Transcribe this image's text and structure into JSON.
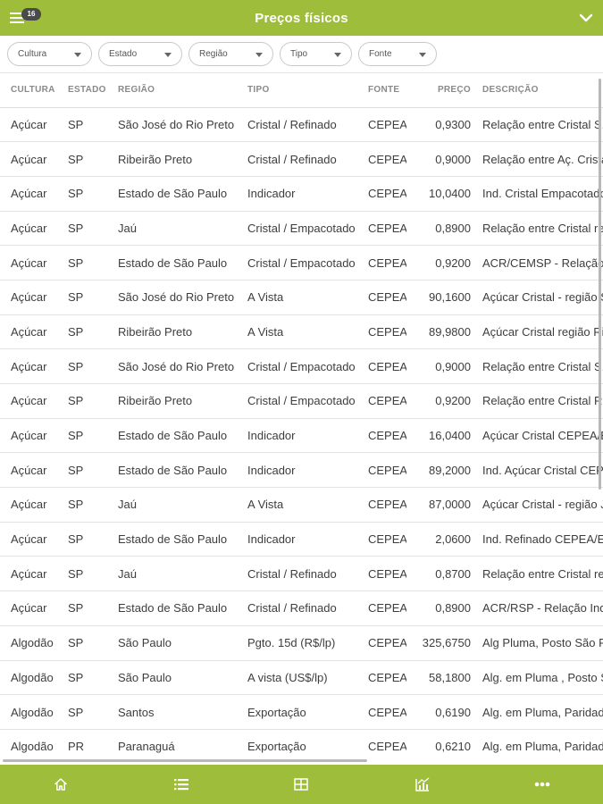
{
  "header": {
    "title": "Preços físicos",
    "menu_badge": "16",
    "menu_icon": "hamburger-menu-icon",
    "collapse_icon": "chevron-down-icon"
  },
  "filters": [
    {
      "label": "Cultura"
    },
    {
      "label": "Estado"
    },
    {
      "label": "Região"
    },
    {
      "label": "Tipo"
    },
    {
      "label": "Fonte"
    }
  ],
  "table": {
    "columns": [
      "CULTURA",
      "ESTADO",
      "REGIÃO",
      "TIPO",
      "FONTE",
      "PREÇO",
      "DESCRIÇÃO"
    ],
    "rows": [
      [
        "Açúcar",
        "SP",
        "São José do Rio Preto",
        "Cristal / Refinado",
        "CEPEA",
        "0,9300",
        "Relação entre Cristal S..."
      ],
      [
        "Açúcar",
        "SP",
        "Ribeirão Preto",
        "Cristal / Refinado",
        "CEPEA",
        "0,9000",
        "Relação entre Aç. Crista"
      ],
      [
        "Açúcar",
        "SP",
        "Estado de São Paulo",
        "Indicador",
        "CEPEA",
        "10,0400",
        "Ind. Cristal Empacotado"
      ],
      [
        "Açúcar",
        "SP",
        "Jaú",
        "Cristal / Empacotado",
        "CEPEA",
        "0,8900",
        "Relação entre Cristal re"
      ],
      [
        "Açúcar",
        "SP",
        "Estado de São Paulo",
        "Cristal / Empacotado",
        "CEPEA",
        "0,9200",
        "ACR/CEMSP - Relação"
      ],
      [
        "Açúcar",
        "SP",
        "São José do Rio Preto",
        "A Vista",
        "CEPEA",
        "90,1600",
        "Açúcar Cristal - região S"
      ],
      [
        "Açúcar",
        "SP",
        "Ribeirão Preto",
        "A Vista",
        "CEPEA",
        "89,9800",
        "Açúcar Cristal região Ri"
      ],
      [
        "Açúcar",
        "SP",
        "São José do Rio Preto",
        "Cristal / Empacotado",
        "CEPEA",
        "0,9000",
        "Relação entre Cristal S."
      ],
      [
        "Açúcar",
        "SP",
        "Ribeirão Preto",
        "Cristal / Empacotado",
        "CEPEA",
        "0,9200",
        "Relação entre Cristal Ri"
      ],
      [
        "Açúcar",
        "SP",
        "Estado de São Paulo",
        "Indicador",
        "CEPEA",
        "16,0400",
        "Açúcar Cristal CEPEA/E"
      ],
      [
        "Açúcar",
        "SP",
        "Estado de São Paulo",
        "Indicador",
        "CEPEA",
        "89,2000",
        "Ind. Açúcar Cristal CEP"
      ],
      [
        "Açúcar",
        "SP",
        "Jaú",
        "A Vista",
        "CEPEA",
        "87,0000",
        "Açúcar Cristal - região J"
      ],
      [
        "Açúcar",
        "SP",
        "Estado de São Paulo",
        "Indicador",
        "CEPEA",
        "2,0600",
        "Ind. Refinado CEPEA/E"
      ],
      [
        "Açúcar",
        "SP",
        "Jaú",
        "Cristal / Refinado",
        "CEPEA",
        "0,8700",
        "Relação entre Cristal re"
      ],
      [
        "Açúcar",
        "SP",
        "Estado de São Paulo",
        "Cristal / Refinado",
        "CEPEA",
        "0,8900",
        "ACR/RSP - Relação Ind"
      ],
      [
        "Algodão",
        "SP",
        "São Paulo",
        "Pgto. 15d (R$/lp)",
        "CEPEA",
        "325,6750",
        "Alg Pluma, Posto São P"
      ],
      [
        "Algodão",
        "SP",
        "São Paulo",
        "A vista (US$/lp)",
        "CEPEA",
        "58,1800",
        "Alg. em Pluma , Posto S"
      ],
      [
        "Algodão",
        "SP",
        "Santos",
        "Exportação",
        "CEPEA",
        "0,6190",
        "Alg. em Pluma, Paridad"
      ],
      [
        "Algodão",
        "PR",
        "Paranaguá",
        "Exportação",
        "CEPEA",
        "0,6210",
        "Alg. em Pluma, Paridad"
      ]
    ]
  },
  "bottom_nav": [
    {
      "icon": "home-icon"
    },
    {
      "icon": "list-icon"
    },
    {
      "icon": "table-grid-icon"
    },
    {
      "icon": "chart-icon"
    },
    {
      "icon": "more-dots-icon"
    }
  ],
  "colors": {
    "brand": "#9dbd3b",
    "badge": "#4a4a4a"
  }
}
